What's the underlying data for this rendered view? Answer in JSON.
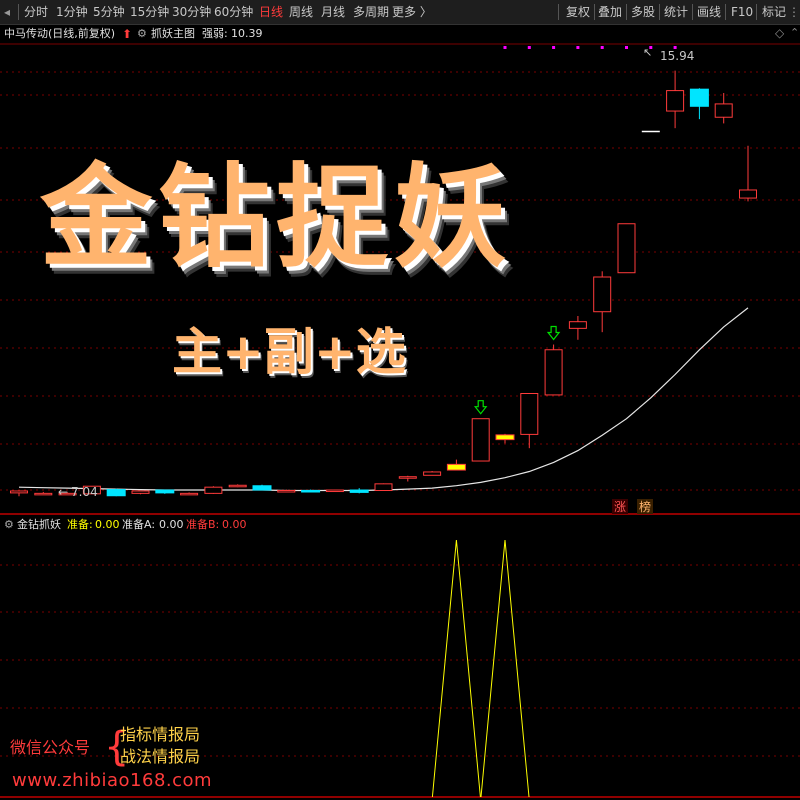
{
  "toolbar": {
    "periods": [
      "分时",
      "1分钟",
      "5分钟",
      "15分钟",
      "30分钟",
      "60分钟",
      "日线",
      "周线",
      "月线",
      "多周期",
      "更多 〉"
    ],
    "active_period": "日线",
    "actions": [
      "复权",
      "叠加",
      "多股",
      "统计",
      "画线",
      "F10",
      "标记"
    ],
    "more_icon": "ellipsis-icon"
  },
  "main_header": {
    "stock": "中马传动(日线,前复权)",
    "indicator": "抓妖主图",
    "strength_label": "强弱:",
    "strength_value": "10.39"
  },
  "sub_header": {
    "indicator": "金钻抓妖",
    "fields": [
      {
        "label": "准备:",
        "value": "0.00",
        "label_color": "#ffff00",
        "value_color": "#ffff00"
      },
      {
        "label": "准备A:",
        "value": "0.00",
        "label_color": "#e0e0e0",
        "value_color": "#e0e0e0"
      },
      {
        "label": "准备B:",
        "value": "0.00",
        "label_color": "#ff3b3b",
        "value_color": "#ff3b3b"
      }
    ]
  },
  "promo": {
    "title": "金钻捉妖",
    "subtitle": "主+副+选",
    "wechat": "微信公众号",
    "brace": "{",
    "account1": "指标情报局",
    "account2": "战法情报局",
    "url": "www.zhibiao168.com"
  },
  "tags": {
    "zhang": "涨",
    "bang": "榜"
  },
  "colors": {
    "up": "#ff3b3b",
    "down": "#00e5ff",
    "signal": "#ffff00",
    "ma": "#e6e6e6",
    "grid": "#7a0000",
    "sep": "#c00000",
    "green": "#00e000",
    "magenta": "#ff00ff"
  },
  "chart_data": {
    "type": "candlestick",
    "price_labels": {
      "high": "15.94",
      "low": "7.04"
    },
    "candles": [
      {
        "o": 7.06,
        "h": 7.11,
        "l": 6.99,
        "c": 7.1
      },
      {
        "o": 7.05,
        "h": 7.08,
        "l": 7.02,
        "c": 7.05
      },
      {
        "o": 7.05,
        "h": 7.07,
        "l": 7.02,
        "c": 7.05
      },
      {
        "o": 7.04,
        "h": 7.2,
        "l": 7.04,
        "c": 7.2
      },
      {
        "o": 7.13,
        "h": 7.15,
        "l": 6.99,
        "c": 7.0
      },
      {
        "o": 7.05,
        "h": 7.11,
        "l": 7.03,
        "c": 7.1
      },
      {
        "o": 7.12,
        "h": 7.13,
        "l": 7.04,
        "c": 7.06
      },
      {
        "o": 7.05,
        "h": 7.07,
        "l": 7.03,
        "c": 7.05
      },
      {
        "o": 7.05,
        "h": 7.2,
        "l": 7.04,
        "c": 7.18
      },
      {
        "o": 7.21,
        "h": 7.24,
        "l": 7.18,
        "c": 7.22
      },
      {
        "o": 7.21,
        "h": 7.23,
        "l": 7.11,
        "c": 7.12
      },
      {
        "o": 7.11,
        "h": 7.13,
        "l": 7.09,
        "c": 7.11
      },
      {
        "o": 7.11,
        "h": 7.13,
        "l": 7.08,
        "c": 7.09
      },
      {
        "o": 7.11,
        "h": 7.13,
        "l": 7.08,
        "c": 7.12
      },
      {
        "o": 7.12,
        "h": 7.16,
        "l": 7.05,
        "c": 7.07
      },
      {
        "o": 7.11,
        "h": 7.26,
        "l": 7.11,
        "c": 7.25
      },
      {
        "o": 7.38,
        "h": 7.42,
        "l": 7.3,
        "c": 7.4
      },
      {
        "o": 7.43,
        "h": 7.52,
        "l": 7.45,
        "c": 7.5
      },
      {
        "o": 7.54,
        "h": 7.76,
        "l": 7.54,
        "c": 7.66
      },
      {
        "o": 7.73,
        "h": 8.62,
        "l": 7.73,
        "c": 8.62
      },
      {
        "o": 8.18,
        "h": 8.3,
        "l": 8.1,
        "c": 8.28
      },
      {
        "o": 8.29,
        "h": 9.15,
        "l": 8.0,
        "c": 9.15
      },
      {
        "o": 9.12,
        "h": 10.18,
        "l": 9.12,
        "c": 10.07
      },
      {
        "o": 10.52,
        "h": 10.78,
        "l": 10.28,
        "c": 10.66
      },
      {
        "o": 10.87,
        "h": 11.72,
        "l": 10.44,
        "c": 11.6
      },
      {
        "o": 11.69,
        "h": 12.72,
        "l": 11.69,
        "c": 12.72
      },
      {
        "o": 14.66,
        "h": 14.66,
        "l": 14.66,
        "c": 14.66
      },
      {
        "o": 15.09,
        "h": 15.94,
        "l": 14.73,
        "c": 15.52
      },
      {
        "o": 15.55,
        "h": 15.57,
        "l": 14.92,
        "c": 15.19
      },
      {
        "o": 14.96,
        "h": 15.47,
        "l": 14.83,
        "c": 15.24
      },
      {
        "o": 13.26,
        "h": 14.36,
        "l": 13.19,
        "c": 13.43
      }
    ],
    "ma_line": [
      7.18,
      7.17,
      7.16,
      7.15,
      7.14,
      7.13,
      7.12,
      7.12,
      7.12,
      7.12,
      7.12,
      7.11,
      7.11,
      7.11,
      7.11,
      7.12,
      7.14,
      7.16,
      7.21,
      7.28,
      7.38,
      7.51,
      7.7,
      7.95,
      8.27,
      8.62,
      9.06,
      9.55,
      10.07,
      10.55,
      10.95
    ],
    "signal_x_indices": [
      18,
      20
    ],
    "buy_arrows": [
      19,
      22
    ],
    "magenta_dots": [
      20,
      21,
      22,
      23,
      24,
      25,
      26,
      27
    ],
    "y_range": [
      6.7,
      16.5
    ]
  }
}
